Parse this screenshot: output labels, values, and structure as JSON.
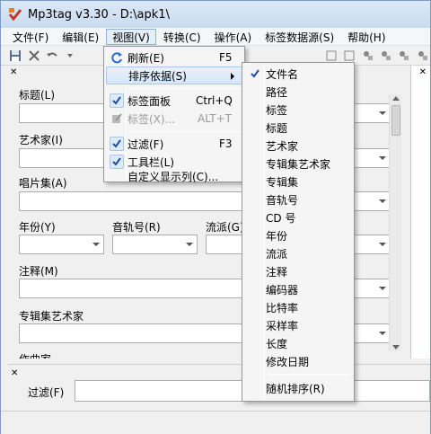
{
  "window": {
    "title": "Mp3tag v3.30  -  D:\\apk1\\"
  },
  "menubar": [
    {
      "label": "文件(F)"
    },
    {
      "label": "编辑(E)"
    },
    {
      "label": "视图(V)"
    },
    {
      "label": "转换(C)"
    },
    {
      "label": "操作(A)"
    },
    {
      "label": "标签数据源(S)"
    },
    {
      "label": "帮助(H)"
    }
  ],
  "tag_panel": {
    "fields": {
      "title": "标题(L)",
      "artist": "艺术家(I)",
      "album": "唱片集(A)",
      "year": "年份(Y)",
      "track": "音轨号(R)",
      "genre": "流派(G)",
      "comment": "注释(M)",
      "album_artist": "专辑集艺术家",
      "composer": "作曲家"
    }
  },
  "filter": {
    "label": "过滤(F)",
    "value": ""
  },
  "view_menu": {
    "items": [
      {
        "label": "刷新(E)",
        "shortcut": "F5",
        "icon": "refresh-icon"
      },
      {
        "label": "排序依据(S)",
        "shortcut": "",
        "submenu": true
      },
      {
        "label": "标签面板",
        "shortcut": "Ctrl+Q",
        "checked": true
      },
      {
        "label": "标签(X)...",
        "shortcut": "ALT+T",
        "disabled": true,
        "icon": "tag-edit-icon"
      },
      {
        "label": "过滤(F)",
        "shortcut": "F3",
        "checked": true
      },
      {
        "label": "工具栏(L)",
        "shortcut": "",
        "checked": true
      },
      {
        "label": "自定义显示列(C)...",
        "shortcut": ""
      }
    ]
  },
  "sort_submenu": {
    "items": [
      {
        "label": "文件名",
        "checked": true
      },
      {
        "label": "路径"
      },
      {
        "label": "标签"
      },
      {
        "label": "标题"
      },
      {
        "label": "艺术家"
      },
      {
        "label": "专辑集艺术家"
      },
      {
        "label": "专辑集"
      },
      {
        "label": "音轨号"
      },
      {
        "label": "CD 号"
      },
      {
        "label": "年份"
      },
      {
        "label": "流派"
      },
      {
        "label": "注释"
      },
      {
        "label": "编码器"
      },
      {
        "label": "比特率"
      },
      {
        "label": "采样率"
      },
      {
        "label": "长度"
      },
      {
        "label": "修改日期"
      },
      {
        "label": "随机排序(R)"
      }
    ]
  },
  "colors": {
    "checkmark": "#1f4e99",
    "highlight_border": "#a8c8eb"
  }
}
